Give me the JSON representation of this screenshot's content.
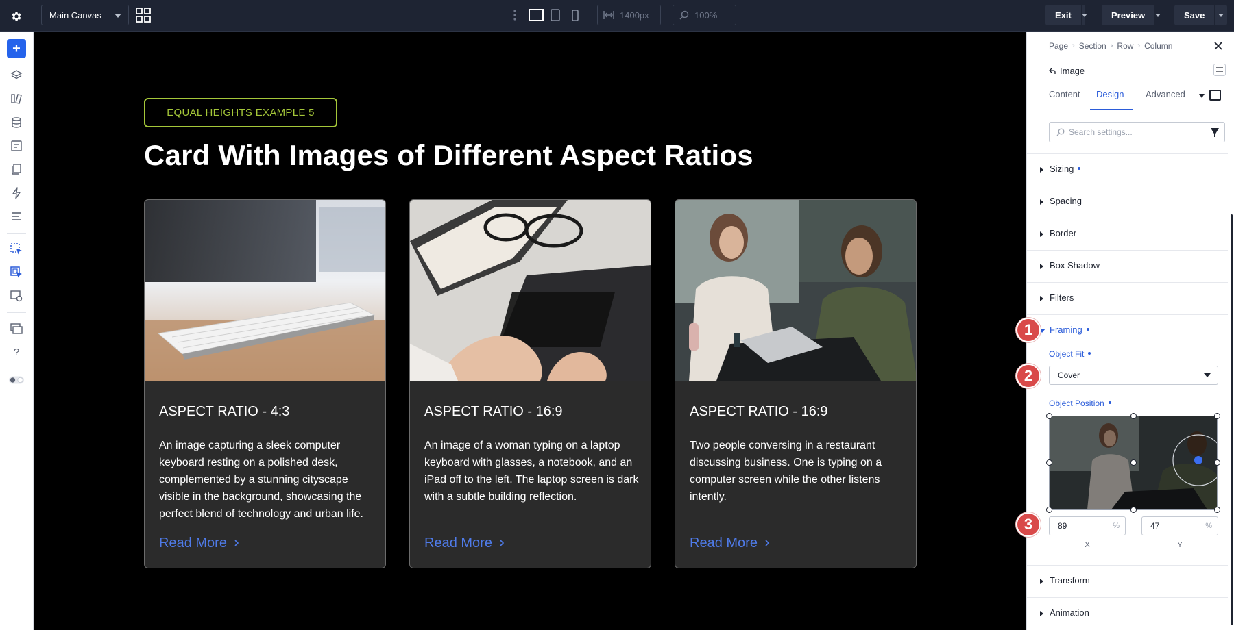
{
  "toolbar": {
    "canvas_select": "Main Canvas",
    "width_value": "1400px",
    "zoom_value": "100%",
    "exit_label": "Exit",
    "preview_label": "Preview",
    "save_label": "Save"
  },
  "canvas": {
    "eyebrow": "EQUAL HEIGHTS EXAMPLE 5",
    "headline": "Card With Images of Different Aspect Ratios",
    "cards": [
      {
        "title": "ASPECT RATIO - 4:3",
        "description": "An image capturing a sleek computer keyboard resting on a polished desk, complemented by a stunning cityscape visible in the background, showcasing the perfect blend of technology and urban life.",
        "link": "Read More"
      },
      {
        "title": "ASPECT RATIO - 16:9",
        "description": "An image of a woman typing on a laptop keyboard with glasses, a notebook, and an iPad off to the left. The laptop screen is dark with a subtle building reflection.",
        "link": "Read More"
      },
      {
        "title": "ASPECT RATIO - 16:9",
        "description": "Two people conversing in a restaurant discussing business. One is typing on a computer screen while the other listens intently.",
        "link": "Read More"
      }
    ]
  },
  "panel": {
    "breadcrumbs": [
      "Page",
      "Section",
      "Row",
      "Column"
    ],
    "element_title": "Image",
    "tabs": [
      "Content",
      "Design",
      "Advanced"
    ],
    "active_tab": "Design",
    "search_placeholder": "Search settings...",
    "sections": [
      "Sizing",
      "Spacing",
      "Border",
      "Box Shadow",
      "Filters",
      "Framing",
      "Transform",
      "Animation"
    ],
    "object_fit_label": "Object Fit",
    "object_fit_value": "Cover",
    "object_position_label": "Object Position",
    "pos_x": "89",
    "pos_y": "47",
    "unit": "%",
    "x_label": "X",
    "y_label": "Y"
  },
  "badges": [
    "1",
    "2",
    "3"
  ],
  "colors": {
    "accent_blue": "#2b5cd9",
    "eyebrow_green": "#a4c639",
    "link_blue": "#4f7be9",
    "badge_red": "#d94a4a",
    "toolbar_bg": "#1e2433"
  }
}
